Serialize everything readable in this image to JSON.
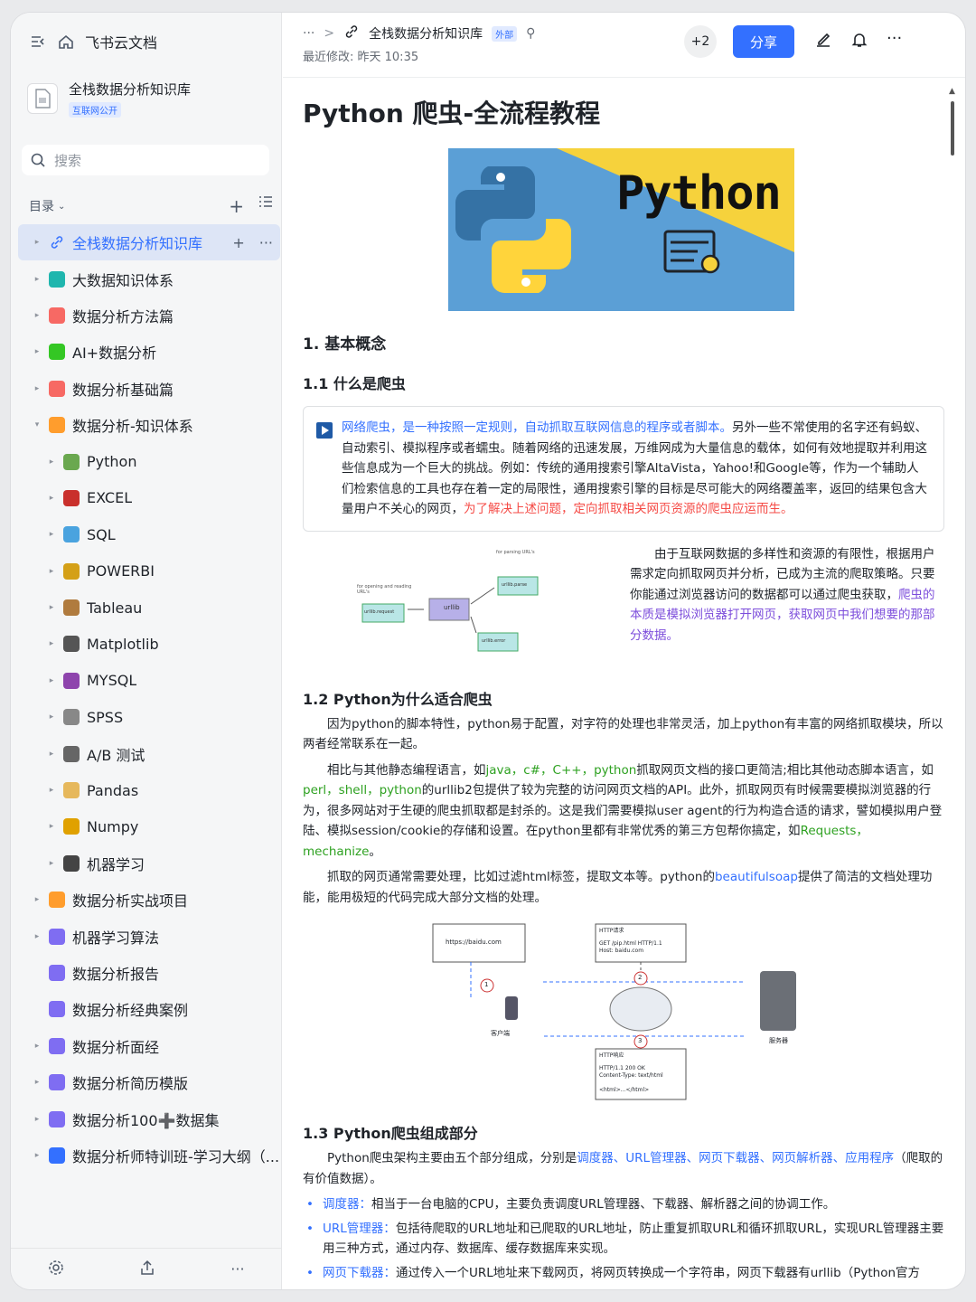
{
  "app": {
    "name": "飞书云文档"
  },
  "kb": {
    "title": "全栈数据分析知识库",
    "tag": "互联网公开"
  },
  "search": {
    "placeholder": "搜索"
  },
  "toc": {
    "label": "目录"
  },
  "tree": [
    {
      "label": "全栈数据分析知识库",
      "level": 0,
      "arrow": "▸",
      "icon": "link",
      "color": "#3370ff",
      "active": true
    },
    {
      "label": "大数据知识体系",
      "level": 0,
      "arrow": "▸",
      "color": "#1fb6ae"
    },
    {
      "label": "数据分析方法篇",
      "level": 0,
      "arrow": "▸",
      "color": "#f76964"
    },
    {
      "label": "AI+数据分析",
      "level": 0,
      "arrow": "▸",
      "color": "#34c724"
    },
    {
      "label": "数据分析基础篇",
      "level": 0,
      "arrow": "▸",
      "color": "#f76964"
    },
    {
      "label": "数据分析-知识体系",
      "level": 0,
      "arrow": "▾",
      "color": "#ff9d2d"
    },
    {
      "label": "Python",
      "level": 1,
      "arrow": "▸",
      "color": "#6aa84f"
    },
    {
      "label": "EXCEL",
      "level": 1,
      "arrow": "▸",
      "color": "#c9302c"
    },
    {
      "label": "SQL",
      "level": 1,
      "arrow": "▸",
      "color": "#4aa3df"
    },
    {
      "label": "POWERBI",
      "level": 1,
      "arrow": "▸",
      "color": "#d4a017"
    },
    {
      "label": "Tableau",
      "level": 1,
      "arrow": "▸",
      "color": "#b07b3e"
    },
    {
      "label": "Matplotlib",
      "level": 1,
      "arrow": "▸",
      "color": "#555555"
    },
    {
      "label": "MYSQL",
      "level": 1,
      "arrow": "▸",
      "color": "#8e44ad"
    },
    {
      "label": "SPSS",
      "level": 1,
      "arrow": "▸",
      "color": "#888888"
    },
    {
      "label": "A/B 测试",
      "level": 1,
      "arrow": "▸",
      "color": "#666666"
    },
    {
      "label": "Pandas",
      "level": 1,
      "arrow": "▸",
      "color": "#e6b85c"
    },
    {
      "label": "Numpy",
      "level": 1,
      "arrow": "▸",
      "color": "#e0a100"
    },
    {
      "label": "机器学习",
      "level": 1,
      "arrow": "▸",
      "color": "#444444"
    },
    {
      "label": "数据分析实战项目",
      "level": 0,
      "arrow": "▸",
      "color": "#ff9d2d"
    },
    {
      "label": "机器学习算法",
      "level": 0,
      "arrow": "▸",
      "color": "#7f6df2"
    },
    {
      "label": "数据分析报告",
      "level": 0,
      "arrow": "",
      "color": "#7f6df2"
    },
    {
      "label": "数据分析经典案例",
      "level": 0,
      "arrow": "",
      "color": "#7f6df2"
    },
    {
      "label": "数据分析面经",
      "level": 0,
      "arrow": "▸",
      "color": "#7f6df2"
    },
    {
      "label": "数据分析简历模版",
      "level": 0,
      "arrow": "▸",
      "color": "#7f6df2"
    },
    {
      "label": "数据分析100➕数据集",
      "level": 0,
      "arrow": "▸",
      "color": "#7f6df2"
    },
    {
      "label": "数据分析师特训班-学习大纲（...",
      "level": 0,
      "arrow": "▸",
      "color": "#3370ff"
    }
  ],
  "header": {
    "dots": "···",
    "sep": ">",
    "title": "全栈数据分析知识库",
    "ext": "外部",
    "modified": "最近修改: 昨天 10:35",
    "collab": "+2",
    "share": "分享"
  },
  "doc": {
    "title": "Python 爬虫-全流程教程",
    "hero_text": "Python",
    "s1": "1. 基本概念",
    "s11": "1.1 什么是爬虫",
    "callout": [
      {
        "t": "网络爬虫，是一种按照一定规则，自动抓取互联网信息的程序或者脚本。",
        "c": "blue"
      },
      {
        "t": "另外一些不常使用的名字还有蚂蚁、自动索引、模拟程序或者蠕虫。随着网络的迅速发展，万维网成为大量信息的载体，如何有效地提取并利用这些信息成为一个巨大的挑战。例如：传统的通用搜索引擎AltaVista，Yahoo!和Google等，作为一个辅助人们检索信息的工具也存在着一定的局限性，通用搜索引擎的目标是尽可能大的网络覆盖率，返回的结果包含大量用户不关心的网页，",
        "c": ""
      },
      {
        "t": "为了解决上述问题，定向抓取相关网页资源的爬虫应运而生。",
        "c": "red"
      }
    ],
    "diagram1": {
      "top": "for parsing URL's",
      "left": "for opening and reading URL's",
      "center": "urllib",
      "b1": "urllib.parse",
      "b2": "urllib.request",
      "b3": "urllib.error"
    },
    "side_text": [
      {
        "t": "由于互联网数据的多样性和资源的有限性，根据用户需求定向抓取网页并分析，已成为主流的爬取策略。只要你能通过浏览器访问的数据都可以通过爬虫获取，",
        "c": ""
      },
      {
        "t": "爬虫的本质是模拟浏览器打开网页，获取网页中我们想要的那部分数据。",
        "c": "purple"
      }
    ],
    "s12": "1.2 Python为什么适合爬虫",
    "p1": "因为python的脚本特性，python易于配置，对字符的处理也非常灵活，加上python有丰富的网络抓取模块，所以两者经常联系在一起。",
    "p2": [
      {
        "t": "相比与其他静态编程语言，如",
        "c": ""
      },
      {
        "t": "java，c#，C++，python",
        "c": "green"
      },
      {
        "t": "抓取网页文档的接口更简洁;相比其他动态脚本语言，如",
        "c": ""
      },
      {
        "t": "perl，shell，python",
        "c": "green"
      },
      {
        "t": "的urllib2包提供了较为完整的访问网页文档的API。此外，抓取网页有时候需要模拟浏览器的行为，很多网站对于生硬的爬虫抓取都是封杀的。这是我们需要模拟user agent的行为构造合适的请求，譬如模拟用户登陆、模拟session/cookie的存储和设置。在python里都有非常优秀的第三方包帮你搞定，如",
        "c": ""
      },
      {
        "t": "Requests，mechanize",
        "c": "green"
      },
      {
        "t": "。",
        "c": ""
      }
    ],
    "p3": [
      {
        "t": "抓取的网页通常需要处理，比如过滤html标签，提取文本等。python的",
        "c": ""
      },
      {
        "t": "beautifulsoap",
        "c": "blue"
      },
      {
        "t": "提供了简洁的文档处理功能，能用极短的代码完成大部分文档的处理。",
        "c": ""
      }
    ],
    "diagram2": {
      "url": "https://baidu.com",
      "req_h": "HTTP请求",
      "req": "GET /pip.html HTTP/1.1",
      "host": "Host: baidu.com",
      "res_h": "HTTP响应",
      "res1": "HTTP/1.1 200 OK",
      "res2": "Content-Type: text/html",
      "res3": "<html>...</html>",
      "client": "客户端",
      "server": "服务器",
      "n1": "1",
      "n2": "2",
      "n3": "3"
    },
    "s13": "1.3 Python爬虫组成部分",
    "p4": [
      {
        "t": "Python爬虫架构主要由五个部分组成，分别是",
        "c": ""
      },
      {
        "t": "调度器、URL管理器、网页下载器、网页解析器、应用程序",
        "c": "blue"
      },
      {
        "t": "（爬取的有价值数据）。",
        "c": ""
      }
    ],
    "bullets": [
      {
        "k": "调度器：",
        "v": "相当于一台电脑的CPU，主要负责调度URL管理器、下载器、解析器之间的协调工作。"
      },
      {
        "k": "URL管理器：",
        "v": "包括待爬取的URL地址和已爬取的URL地址，防止重复抓取URL和循环抓取URL，实现URL管理器主要用三种方式，通过内存、数据库、缓存数据库来实现。"
      },
      {
        "k": "网页下载器：",
        "v": "通过传入一个URL地址来下载网页，将网页转换成一个字符串，网页下载器有urllib（Python官方"
      }
    ]
  }
}
